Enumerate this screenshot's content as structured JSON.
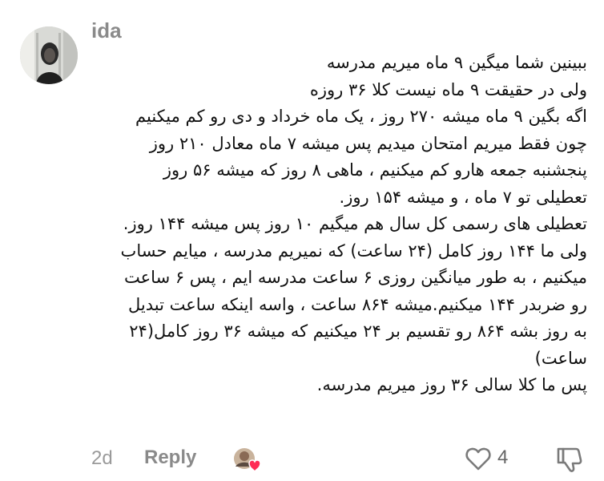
{
  "comment": {
    "username": "ida",
    "lines": [
      "ببینین شما میگین ۹ ماه میریم مدرسه",
      "ولی در حقیقت ۹ ماه نیست کلا ۳۶ روزه",
      "اگه بگین ۹ ماه میشه ۲۷۰ روز ، یک ماه خرداد و دی رو کم میکنیم",
      "چون فقط میریم امتحان میدیم پس میشه ۷ ماه معادل ۲۱۰ روز",
      "پنجشنبه جمعه هارو کم میکنیم ، ماهی ۸ روز که میشه ۵۶ روز",
      "تعطیلی تو ۷ ماه ، و میشه ۱۵۴ روز.",
      "تعطیلی های رسمی کل سال هم میگیم ۱۰ روز پس میشه ۱۴۴ روز.",
      "ولی ما ۱۴۴ روز کامل (۲۴ ساعت) که نمیریم مدرسه ، میایم حساب",
      "میکنیم ، به طور میانگین روزی ۶ ساعت مدرسه ایم ، پس ۶ ساعت",
      "رو ضربدر ۱۴۴ میکنیم.میشه ۸۶۴ ساعت ، واسه اینکه ساعت تبدیل",
      "به روز بشه ۸۶۴ رو تقسیم بر ۲۴ میکنیم که میشه ۳۶ روز کامل(۲۴",
      "ساعت)",
      "پس ما کلا سالی ۳۶ روز میریم مدرسه."
    ]
  },
  "footer": {
    "time": "2d",
    "reply_label": "Reply",
    "like_count": "4"
  },
  "icons": {
    "like": "heart-outline-icon",
    "dislike": "thumbs-down-icon",
    "reaction": "creator-liked-avatar-icon"
  },
  "colors": {
    "muted_text": "#8a8a8a",
    "body_text": "#111111",
    "heart_accent": "#fe2c55"
  }
}
